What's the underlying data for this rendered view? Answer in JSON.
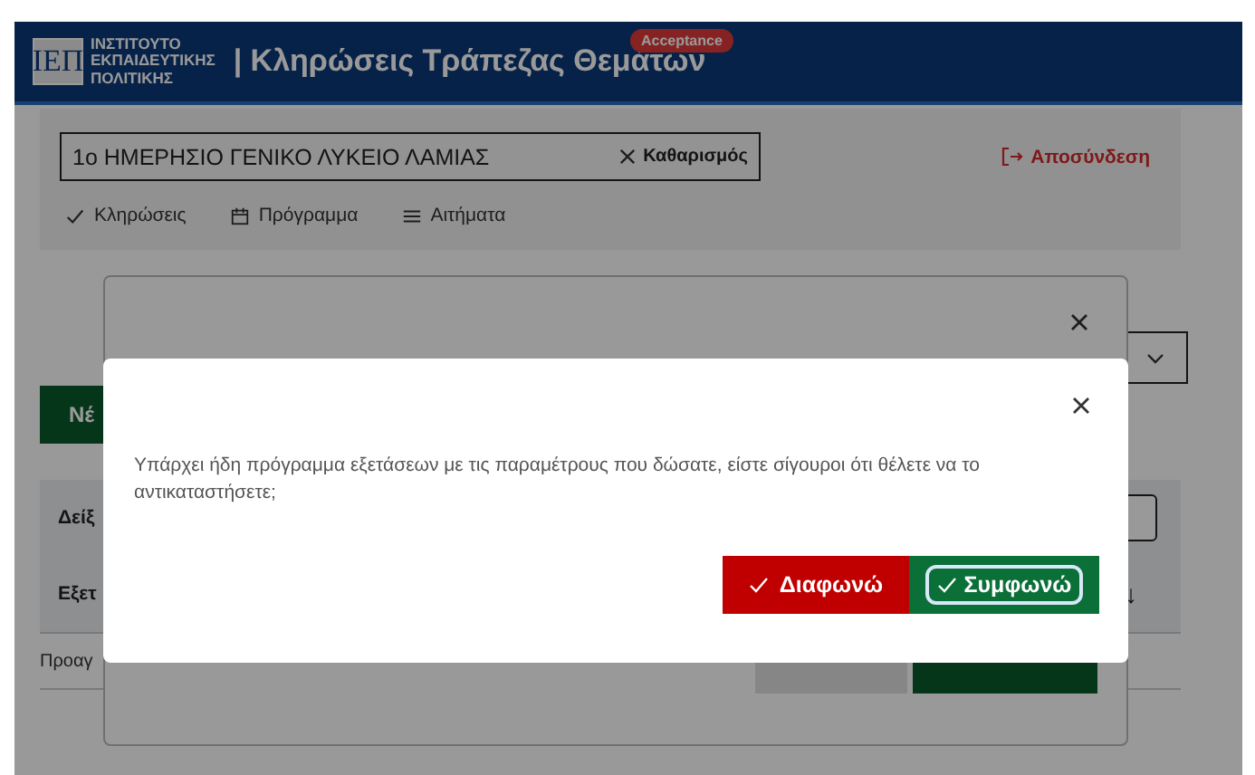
{
  "header": {
    "logo_mark": "ΙΕΠ",
    "logo_lines": [
      "ΙΝΣΤΙΤΟΥΤΟ",
      "ΕΚΠΑΙΔΕΥΤΙΚΗΣ",
      "ΠΟΛΙΤΙΚΗΣ"
    ],
    "title": "| Κληρώσεις Τράπεζας Θεμάτων",
    "badge": "Acceptance"
  },
  "school_field": {
    "value": "1ο ΗΜΕΡΗΣΙΟ ΓΕΝΙΚΟ ΛΥΚΕΙΟ ΛΑΜΙΑΣ",
    "clear": "Καθαρισμός"
  },
  "logout": "Αποσύνδεση",
  "nav": [
    {
      "label": "Κληρώσεις",
      "kind": "draws"
    },
    {
      "label": "Πρόγραμμα",
      "kind": "schedule"
    },
    {
      "label": "Αιτήματα",
      "kind": "requests"
    }
  ],
  "new_button": "Νέ",
  "filter": {
    "label": "Δείξ"
  },
  "table": {
    "columns": [
      "Εξετ"
    ],
    "sort": "↓",
    "rows": [
      "Προαγ"
    ]
  },
  "dialog": {
    "message": "Υπάρχει ήδη πρόγραμμα εξετάσεων με τις παραμέτρους που δώσατε, είστε σίγουροι ότι θέλετε να το αντικαταστήσετε;",
    "buttons": [
      {
        "label": "Διαφωνώ",
        "kind": "danger",
        "focused": false
      },
      {
        "label": "Συμφωνώ",
        "kind": "confirm",
        "focused": true
      }
    ]
  }
}
